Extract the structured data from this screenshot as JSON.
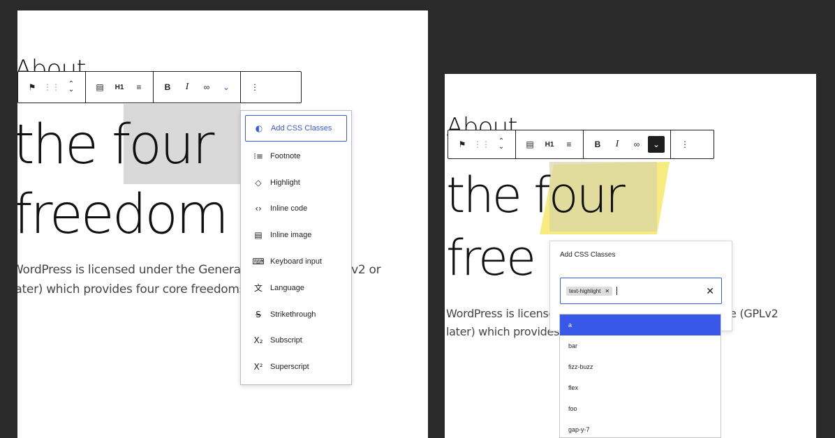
{
  "left": {
    "heading_small": "About",
    "heading_line1_a": "the ",
    "heading_line1_b": "four",
    "heading_line2": "freedom",
    "para_line1": "WordPress is licensed under the GeneralPublicLicense (GPLv2 or",
    "para_line2": "later) which provides four core freedoms"
  },
  "right": {
    "heading_small": "About",
    "heading_line1_a": "the ",
    "heading_line1_b": "four",
    "heading_line2": "free",
    "para_line1": "WordPress is licensed under the GeneralPublicLicense (GPLv2",
    "para_line2": "later) which provides four core freedoms"
  },
  "toolbar": {
    "heading_level": "H1",
    "bold": "B",
    "italic": "I"
  },
  "format_menu": {
    "items": [
      {
        "icon": "css-class-icon",
        "glyph": "◐",
        "label": "Add CSS Classes"
      },
      {
        "icon": "footnote-icon",
        "glyph": "⁝≡",
        "label": "Footnote"
      },
      {
        "icon": "highlight-icon",
        "glyph": "◇",
        "label": "Highlight"
      },
      {
        "icon": "code-icon",
        "glyph": "‹›",
        "label": "Inline code"
      },
      {
        "icon": "image-icon",
        "glyph": "▤",
        "label": "Inline image"
      },
      {
        "icon": "keyboard-icon",
        "glyph": "⌨",
        "label": "Keyboard input"
      },
      {
        "icon": "language-icon",
        "glyph": "文",
        "label": "Language"
      },
      {
        "icon": "strikethrough-icon",
        "glyph": "S̶",
        "label": "Strikethrough"
      },
      {
        "icon": "subscript-icon",
        "glyph": "X₂",
        "label": "Subscript"
      },
      {
        "icon": "superscript-icon",
        "glyph": "X²",
        "label": "Superscript"
      }
    ]
  },
  "css_popover": {
    "title": "Add CSS Classes",
    "token": "text-highlight",
    "suggestions": [
      "a",
      "bar",
      "fizz-buzz",
      "flex",
      "foo",
      "gap-y-7"
    ]
  },
  "colors": {
    "accent": "#3858e9",
    "highlight_gray": "#d9d9d9",
    "highlight_yellow": "#f6ec7f"
  }
}
